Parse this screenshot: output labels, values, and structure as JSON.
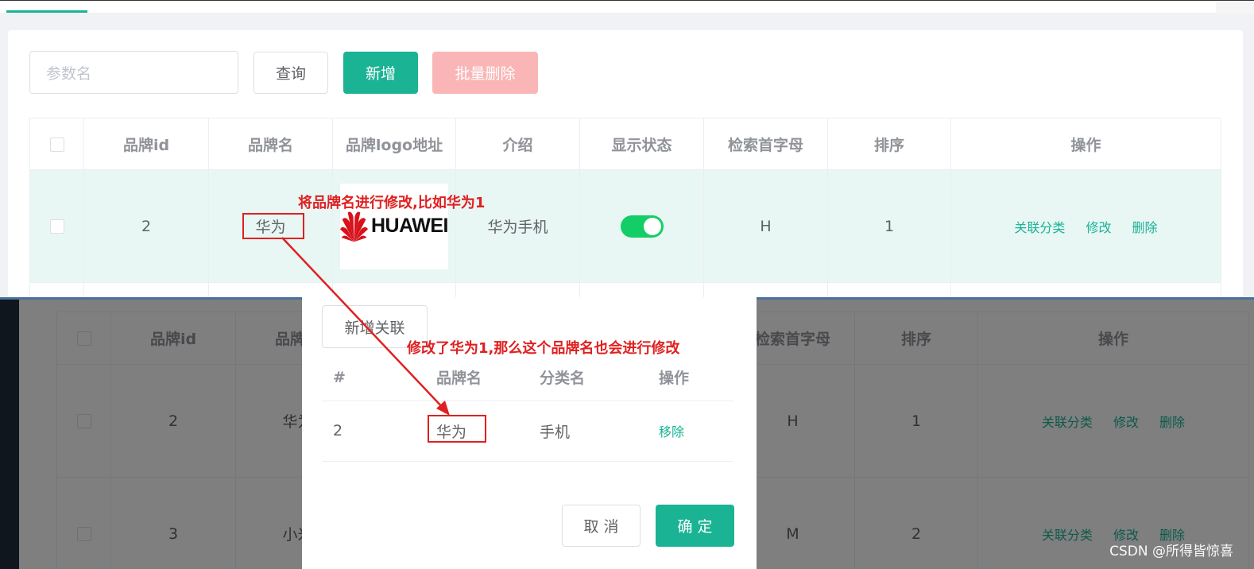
{
  "toolbar": {
    "search_placeholder": "参数名",
    "query_label": "查询",
    "add_label": "新增",
    "batch_delete_label": "批量删除"
  },
  "table": {
    "headers": [
      "品牌id",
      "品牌名",
      "品牌logo地址",
      "介绍",
      "显示状态",
      "检索首字母",
      "排序",
      "操作"
    ],
    "rows": [
      {
        "id": "2",
        "name": "华为",
        "logo_text": "HUAWEI",
        "intro": "华为手机",
        "status": true,
        "letter": "H",
        "sort": "1"
      },
      {
        "id": "3",
        "name": "小米",
        "letter": "M",
        "sort": "2"
      }
    ],
    "actions": {
      "relate": "关联分类",
      "edit": "修改",
      "delete": "删除"
    }
  },
  "dialog": {
    "add_relation_label": "新增关联",
    "headers": [
      "#",
      "品牌名",
      "分类名",
      "操作"
    ],
    "rows": [
      {
        "index": "2",
        "brand": "华为",
        "category": "手机",
        "action": "移除"
      }
    ],
    "cancel_label": "取 消",
    "confirm_label": "确 定"
  },
  "annotations": {
    "top": "将品牌名进行修改,比如华为1",
    "bottom": "修改了华为1,那么这个品牌名也会进行修改"
  },
  "watermark": "CSDN @所得皆惊喜",
  "colors": {
    "accent": "#1ab394",
    "annotation": "#e02020",
    "switch_on": "#13ce66"
  }
}
